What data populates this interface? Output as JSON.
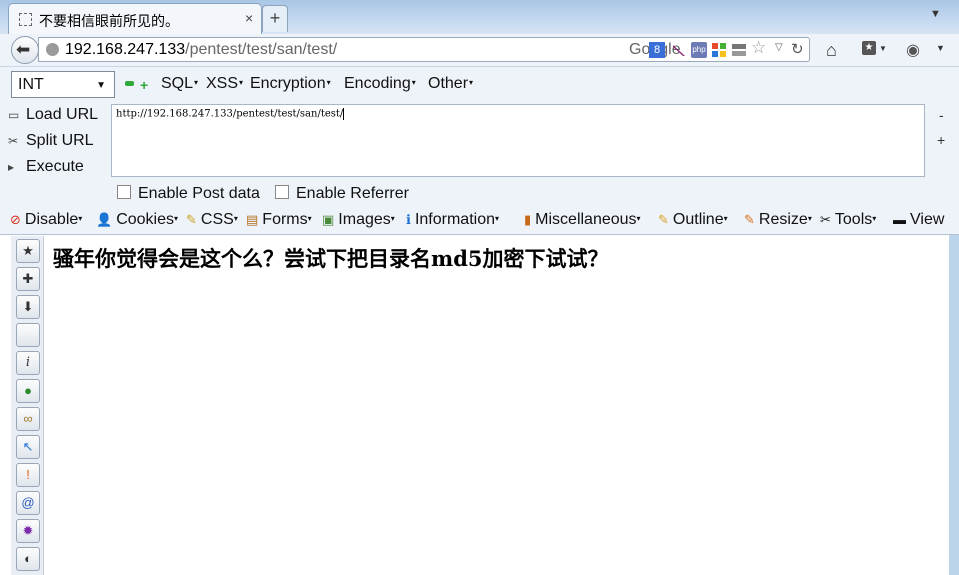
{
  "tab": {
    "title": "不要相信眼前所见的。",
    "close": "×",
    "new_tab": "+"
  },
  "navbar": {
    "url_host": "192.168.247.133",
    "url_path": "/pentest/test/san/test/",
    "search_engine": "Google"
  },
  "hackbar": {
    "encoding_select": "INT",
    "menus": [
      "SQL",
      "XSS",
      "Encryption",
      "Encoding",
      "Other"
    ],
    "actions": [
      "Load URL",
      "Split URL",
      "Execute"
    ],
    "textarea": "http://192.168.247.133/pentest/test/san/test/",
    "side_minus": "-",
    "side_plus": "+",
    "enable_post": "Enable Post data",
    "enable_referrer": "Enable Referrer"
  },
  "webdev": {
    "items": [
      "Disable",
      "Cookies",
      "CSS",
      "Forms",
      "Images",
      "Information",
      "Miscellaneous",
      "Outline",
      "Resize",
      "Tools",
      "View"
    ]
  },
  "page": {
    "text": "骚年你觉得会是这个么？尝试下把目录名md5加密下试试？"
  },
  "colors": {
    "frame": "#bcd4ea",
    "toolbar": "#eef3f9",
    "green": "#31a83a"
  }
}
